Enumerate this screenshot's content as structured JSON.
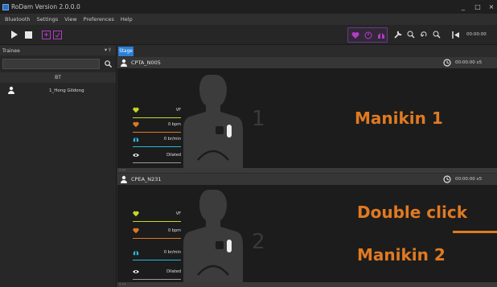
{
  "window": {
    "title": "RoDam Version 2.0.0.0",
    "controls": {
      "minimize": "_",
      "maximize": "□",
      "close": "×"
    }
  },
  "menu": [
    "Bluetooth",
    "Settings",
    "View",
    "Preferences",
    "Help"
  ],
  "toolbar": {
    "time": "00:00:00"
  },
  "left_panel": {
    "title": "Trainee",
    "pin": "▾ ⫯",
    "search_placeholder": "",
    "group_header": "BT",
    "trainees": [
      {
        "name": "1_Hong Gildong"
      }
    ]
  },
  "stage_tab": "Stage",
  "manikins": [
    {
      "name": "CPTA_N005",
      "time": "00:00:00 x5",
      "number": "1",
      "vitals": {
        "rhythm": "VF",
        "heart_rate": "0 bpm",
        "breath_rate": "0 br/min",
        "pupil": "Dilated"
      }
    },
    {
      "name": "CPEA_N231",
      "time": "00:00:00 x5",
      "number": "2",
      "vitals": {
        "rhythm": "VF",
        "heart_rate": "0 bpm",
        "breath_rate": "0 br/min",
        "pupil": "Dilated"
      }
    }
  ],
  "annotations": {
    "manikin1": "Manikin 1",
    "double_click": "Double click",
    "manikin2": "Manikin 2"
  },
  "colors": {
    "accent_blue": "#2a7fd6",
    "annotation_orange": "#e07a22",
    "vital_yellow": "#c8d82a",
    "vital_orange": "#e07a22",
    "vital_cyan": "#2bb8d8",
    "toolbar_purple": "#b33cc8"
  }
}
